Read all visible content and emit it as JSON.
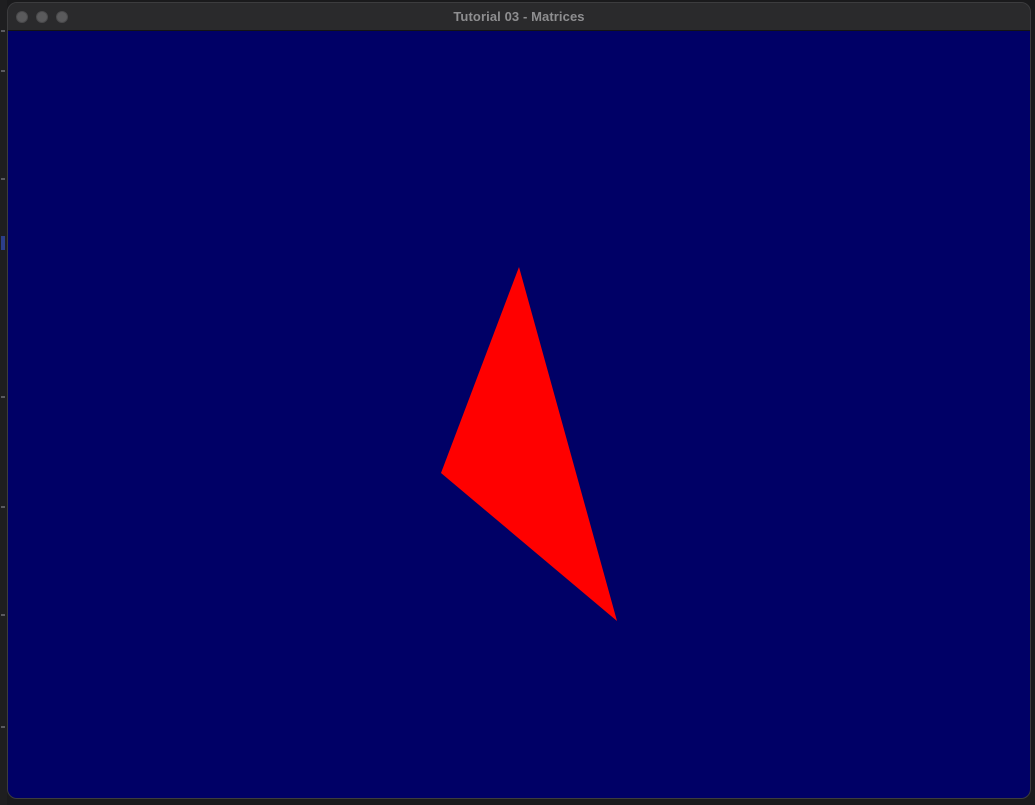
{
  "window": {
    "title": "Tutorial 03 - Matrices"
  },
  "scene": {
    "clear_color": "#000066",
    "triangle_color": "#ff0000"
  }
}
